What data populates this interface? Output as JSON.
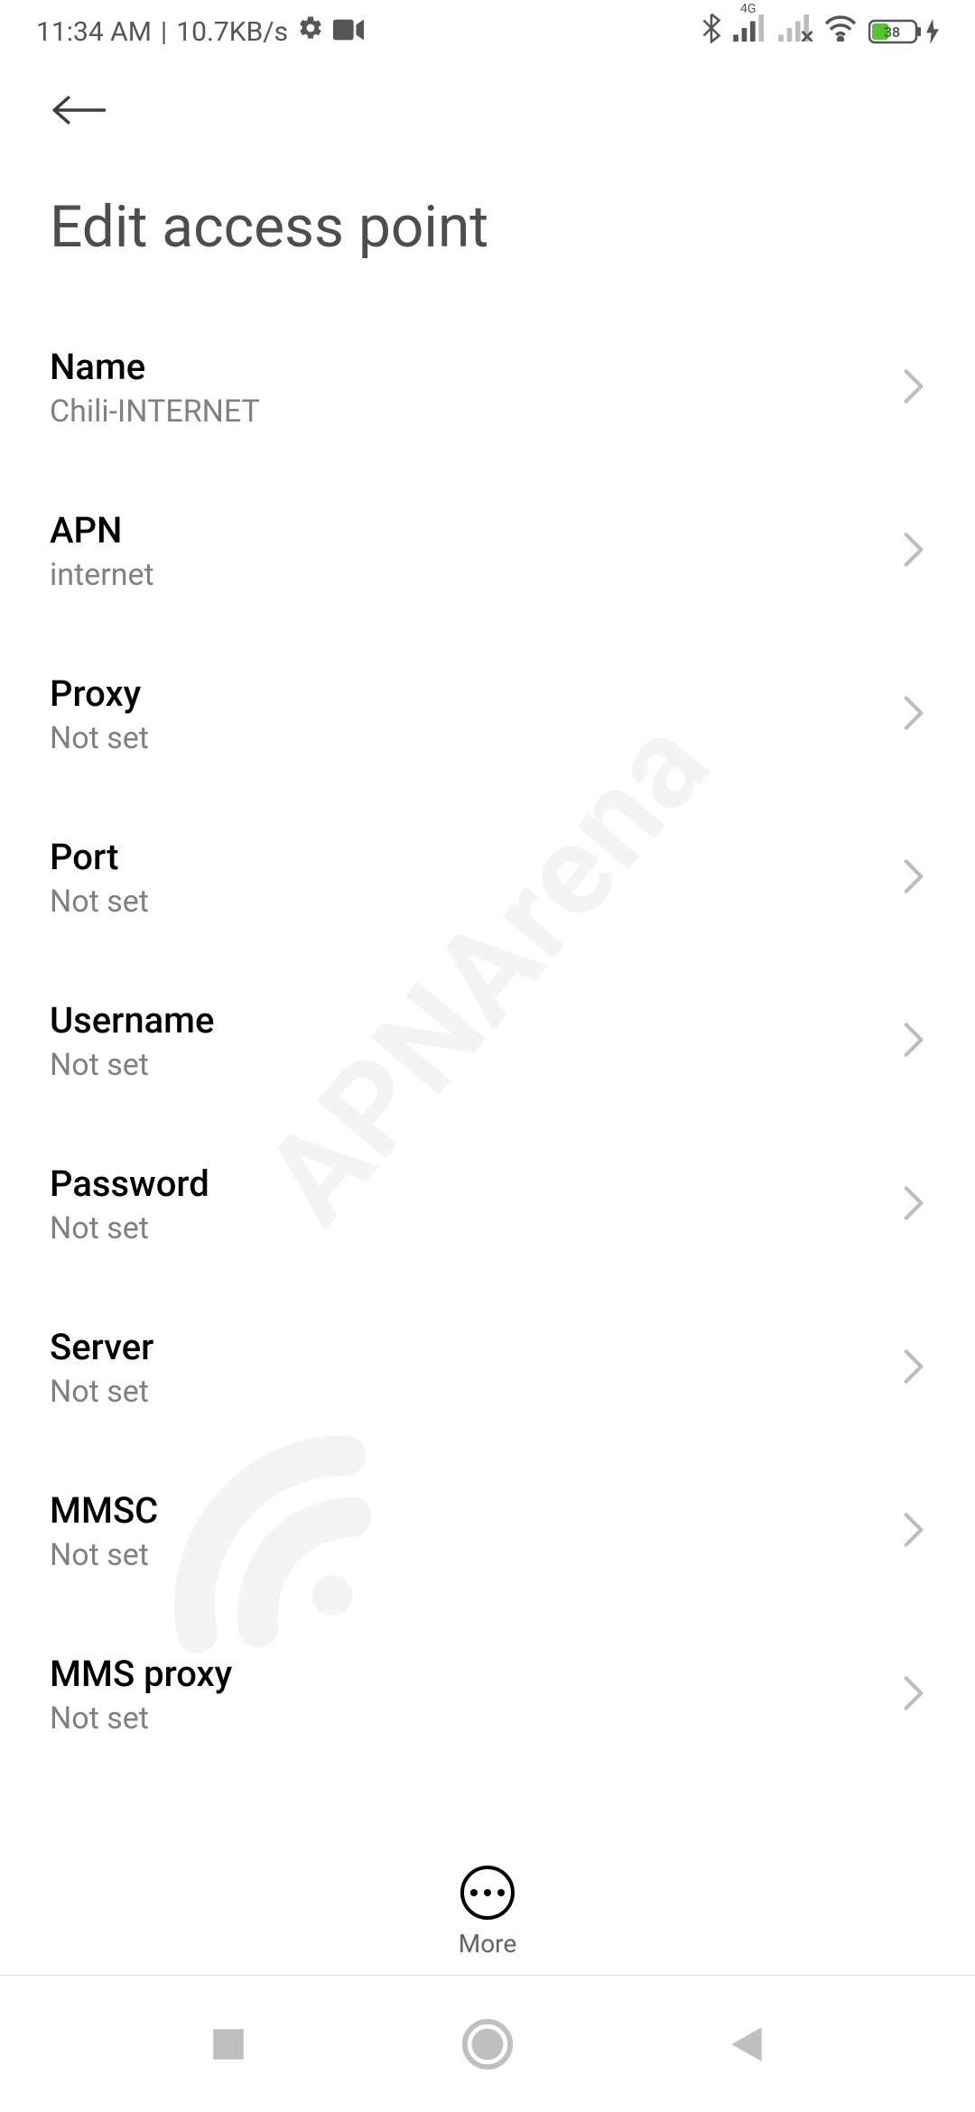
{
  "status": {
    "time": "11:34 AM",
    "net_speed": "10.7KB/s",
    "net_label": "4G",
    "battery_pct": "38"
  },
  "page": {
    "title": "Edit access point"
  },
  "rows": [
    {
      "label": "Name",
      "value": "Chili-INTERNET"
    },
    {
      "label": "APN",
      "value": "internet"
    },
    {
      "label": "Proxy",
      "value": "Not set"
    },
    {
      "label": "Port",
      "value": "Not set"
    },
    {
      "label": "Username",
      "value": "Not set"
    },
    {
      "label": "Password",
      "value": "Not set"
    },
    {
      "label": "Server",
      "value": "Not set"
    },
    {
      "label": "MMSC",
      "value": "Not set"
    },
    {
      "label": "MMS proxy",
      "value": "Not set"
    }
  ],
  "more": {
    "label": "More"
  },
  "watermark": "APNArena"
}
